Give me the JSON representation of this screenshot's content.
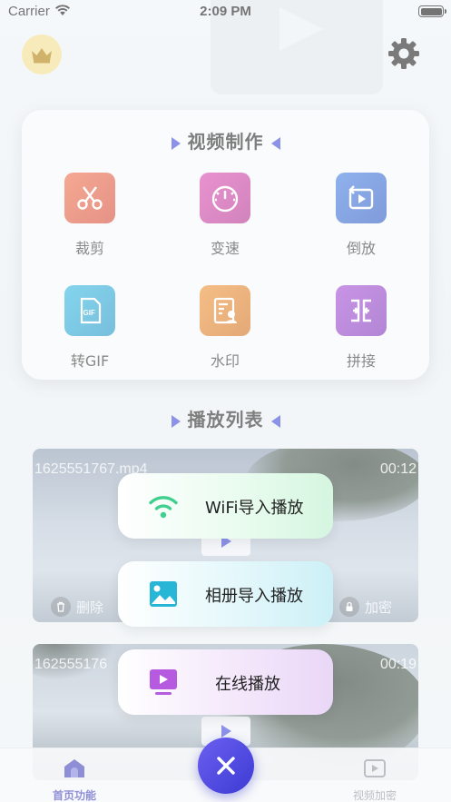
{
  "status_bar": {
    "carrier": "Carrier",
    "time": "2:09 PM"
  },
  "header": {
    "vip_icon": "crown-icon",
    "settings_icon": "gear-icon"
  },
  "video_make": {
    "title": "视频制作",
    "tools": [
      {
        "label": "裁剪",
        "icon": "scissors-icon",
        "color": "#e0553a"
      },
      {
        "label": "变速",
        "icon": "speedometer-icon",
        "color": "#c8379e"
      },
      {
        "label": "倒放",
        "icon": "reverse-play-icon",
        "color": "#2f66d0"
      },
      {
        "label": "转GIF",
        "icon": "gif-icon",
        "color": "#1f9fd0"
      },
      {
        "label": "水印",
        "icon": "watermark-icon",
        "color": "#df7e22"
      },
      {
        "label": "拼接",
        "icon": "merge-icon",
        "color": "#8a39c7"
      }
    ]
  },
  "playlist": {
    "title": "播放列表",
    "items": [
      {
        "name": "1625551767.mp4",
        "duration": "00:12",
        "delete_label": "删除",
        "encrypt_label": "加密"
      },
      {
        "name": "162555176",
        "duration": "00:19"
      }
    ]
  },
  "import_menu": {
    "options": [
      {
        "label": "WiFi导入播放",
        "icon": "wifi-icon",
        "accent": "#3fcf8e"
      },
      {
        "label": "相册导入播放",
        "icon": "photo-album-icon",
        "accent": "#27b6d6"
      },
      {
        "label": "在线播放",
        "icon": "online-tv-icon",
        "accent": "#b65be0"
      }
    ]
  },
  "tabbar": {
    "tabs": [
      {
        "label": "首页功能",
        "icon": "home-icon",
        "active": true
      },
      {
        "label": "视频加密",
        "icon": "video-lock-icon",
        "active": false
      }
    ],
    "close_icon": "close-icon"
  },
  "colors": {
    "accent": "#3a44d8",
    "active_tab": "#3d3db8"
  }
}
